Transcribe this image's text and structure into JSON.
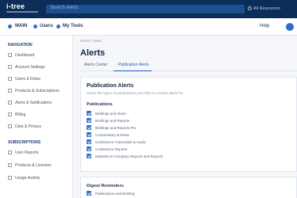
{
  "topbar": {
    "logo": "i-tree",
    "search_placeholder": "Search Alerts",
    "right_label": "All Resources"
  },
  "nav": {
    "items": [
      "MAIN",
      "Users",
      "My Tools"
    ],
    "help": "Help"
  },
  "sidebar": {
    "section1_title": "NAVIGATION",
    "section1_items": [
      "Dashboard",
      "Account Settings",
      "Users & Roles",
      "Products & Subscriptions",
      "Alerts & Notifications",
      "Billing",
      "Data & Privacy"
    ],
    "section2_title": "SUBSCRIPTIONS",
    "section2_items": [
      "User Reports",
      "Products & Licenses",
      "Usage Activity"
    ]
  },
  "main": {
    "breadcrumb": "Home / Alerts",
    "title": "Alerts",
    "tabs": [
      "Alerts Center",
      "Publication Alerts"
    ],
    "card": {
      "title": "Publication Alerts",
      "description": "Select the types of publications you'd like to receive alerts for.",
      "group_label": "Publications",
      "options": [
        "Briefings and Alerts",
        "Briefings and Reports",
        "Briefings and Reports Pro",
        "Commentary & News",
        "Conference Transcripts & Audio",
        "Conference Reports",
        "Datasets & Company Reports and Reports"
      ]
    },
    "card2": {
      "title": "Digest Reminders",
      "option": "Publications and Briefing"
    }
  }
}
